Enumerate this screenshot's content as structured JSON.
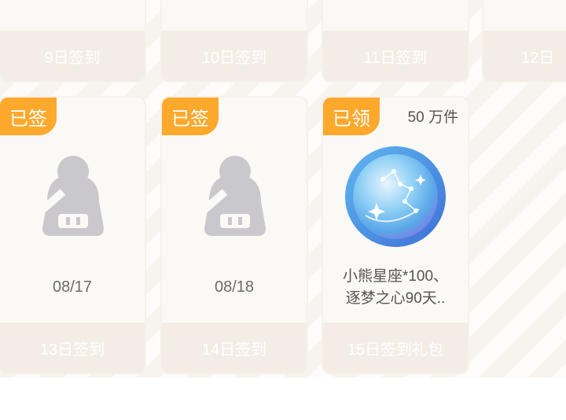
{
  "top_row": [
    {
      "label": "9日签到"
    },
    {
      "label": "10日签到"
    },
    {
      "label": "11日签到"
    },
    {
      "label": "12日"
    }
  ],
  "bottom_row": [
    {
      "badge": "已签",
      "date": "08/17",
      "footer": "13日签到"
    },
    {
      "badge": "已签",
      "date": "08/18",
      "footer": "14日签到"
    },
    {
      "badge": "已领",
      "quantity": "50 万件",
      "desc_line1": "小熊星座*100、",
      "desc_line2": "逐梦之心90天..",
      "footer": "15日签到礼包"
    }
  ],
  "colors": {
    "badge": "#fea82c",
    "footer_bg": "#f4ede5",
    "avatar": "#c9c8cc"
  },
  "icons": {
    "avatar": "user-placeholder-icon",
    "reward": "constellation-coin-icon"
  }
}
